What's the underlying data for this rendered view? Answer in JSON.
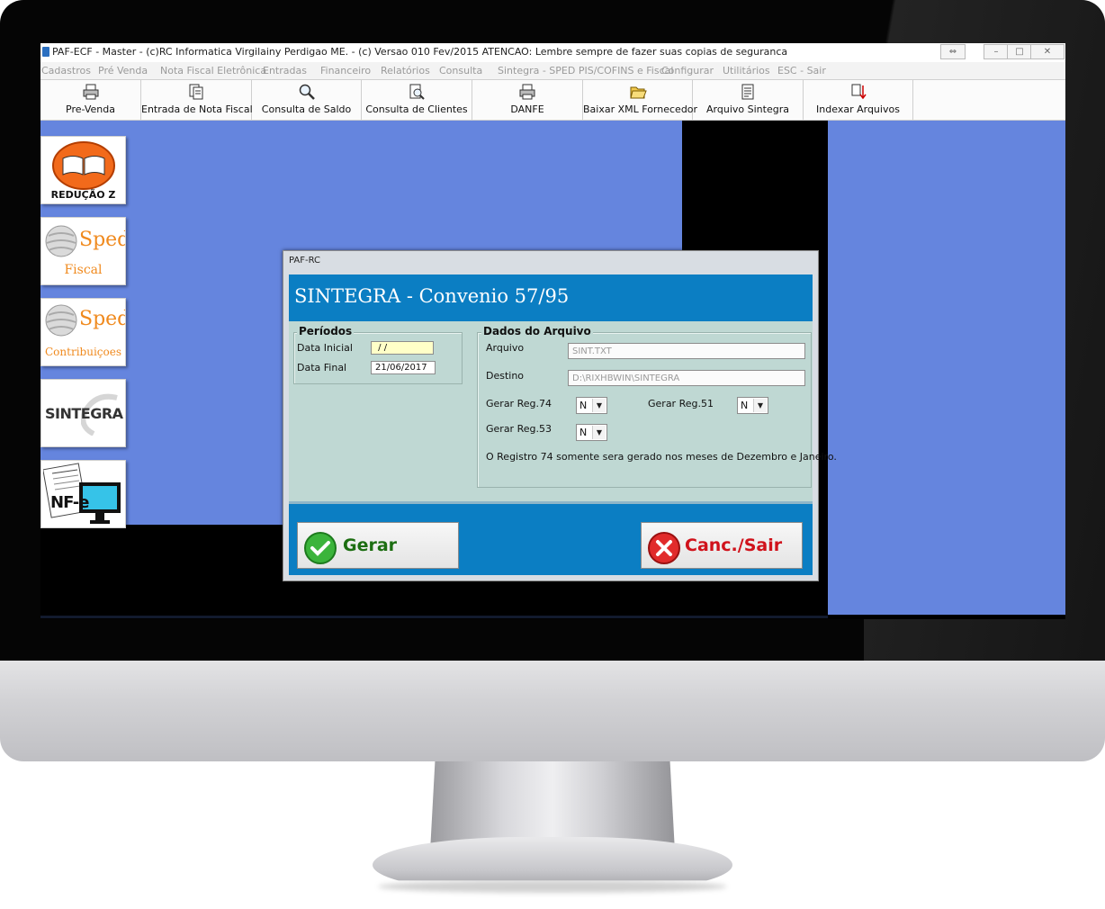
{
  "window": {
    "title": "PAF-ECF - Master - (c)RC Informatica Virgilainy Perdigao ME.  - (c) Versao 010 Fev/2015 ATENCAO: Lembre sempre de fazer suas copias de seguranca"
  },
  "menu": {
    "items": [
      "Cadastros",
      "Pré Venda",
      "Nota Fiscal Eletrônica",
      "Entradas",
      "Financeiro",
      "Relatórios",
      "Consulta",
      "Sintegra - SPED PIS/COFINS e Fiscal",
      "Configurar",
      "Utilitários",
      "ESC - Sair"
    ]
  },
  "toolbar": {
    "buttons": [
      {
        "label": "Pre-Venda",
        "icon": "printer-icon"
      },
      {
        "label": "Entrada de Nota Fiscal",
        "icon": "documents-icon"
      },
      {
        "label": "Consulta de Saldo",
        "icon": "magnifier-icon"
      },
      {
        "label": "Consulta de Clientes",
        "icon": "document-search-icon"
      },
      {
        "label": "DANFE",
        "icon": "printer-icon"
      },
      {
        "label": "Baixar XML Fornecedor",
        "icon": "open-folder-icon"
      },
      {
        "label": "Arquivo Sintegra",
        "icon": "report-icon"
      },
      {
        "label": "Indexar Arquivos",
        "icon": "index-arrow-icon"
      }
    ]
  },
  "sidebar": {
    "tiles": [
      {
        "label": "REDUÇÃO Z",
        "icon": "book-icon"
      },
      {
        "label": "Sped",
        "sublabel": "Fiscal",
        "icon": "sped-logo-icon"
      },
      {
        "label": "Sped",
        "sublabel": "Contribuiçoes",
        "icon": "sped-logo-icon"
      },
      {
        "label": "SINTEGRA",
        "icon": "sintegra-logo-icon"
      },
      {
        "label": "NF-e",
        "icon": "nfe-logo-icon"
      }
    ]
  },
  "dialog": {
    "caption": "PAF-RC",
    "heading": "SINTEGRA - Convenio 57/95",
    "periods": {
      "title": "Períodos",
      "start_label": "Data Inicial",
      "start_value": " / /",
      "end_label": "Data Final",
      "end_value": "21/06/2017"
    },
    "file": {
      "title": "Dados do Arquivo",
      "file_label": "Arquivo",
      "file_value": "SINT.TXT",
      "dest_label": "Destino",
      "dest_value": "D:\\RIXHBWIN\\SINTEGRA",
      "reg74_label": "Gerar Reg.74",
      "reg74_value": "N",
      "reg51_label": "Gerar Reg.51",
      "reg51_value": "N",
      "reg53_label": "Gerar Reg.53",
      "reg53_value": "N",
      "note": "O Registro 74 somente sera gerado nos meses de Dezembro e Janeiro."
    },
    "buttons": {
      "generate": "Gerar",
      "cancel": "Canc./Sair"
    }
  },
  "colors": {
    "desktop": "#6585de",
    "banner": "#0b7ec3",
    "panel": "#bfd8d3",
    "generate_text": "#1d6e12",
    "cancel_text": "#d0121b"
  }
}
